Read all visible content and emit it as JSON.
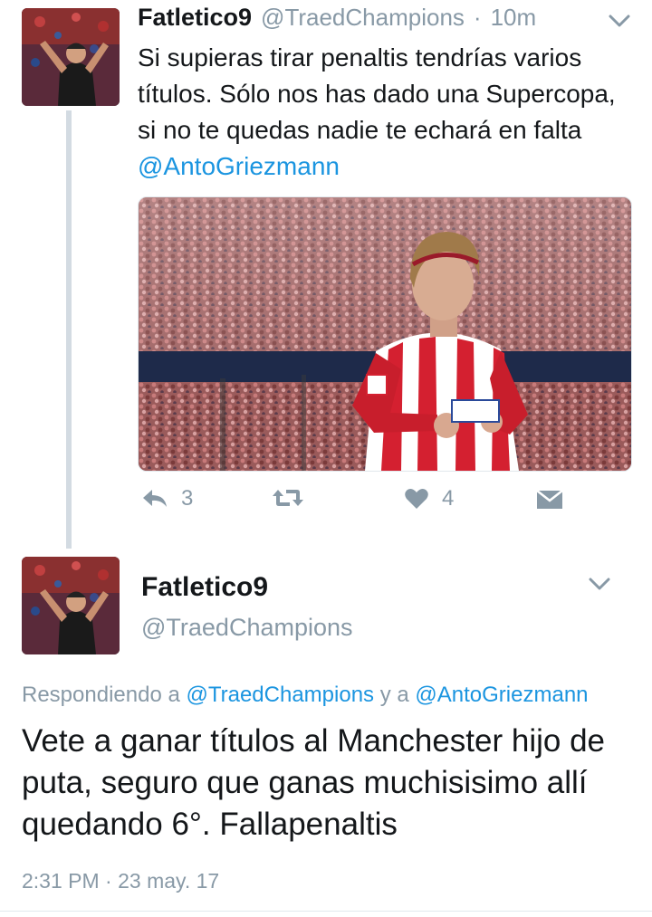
{
  "tweet1": {
    "display_name": "Fatletico9",
    "handle": "@TraedChampions",
    "separator": "·",
    "time": "10m",
    "text": "Si supieras tirar penaltis tendrías varios títulos. Sólo nos has dado una Supercopa, si no te quedas nadie te echará en falta",
    "mention": "@AntoGriezmann",
    "actions": {
      "reply_count": "3",
      "like_count": "4"
    },
    "icons": [
      "reply-icon",
      "retweet-icon",
      "heart-icon",
      "direct-message-icon",
      "chevron-down-icon"
    ]
  },
  "tweet2": {
    "display_name": "Fatletico9",
    "handle": "@TraedChampions",
    "replying_prefix": "Respondiendo a",
    "replying_user1": "@TraedChampions",
    "replying_conj": "y a",
    "replying_user2": "@AntoGriezmann",
    "text": "Vete a ganar títulos al Manchester hijo de puta, seguro que ganas muchisisimo allí quedando 6°. Fallapenaltis",
    "time": "2:31 PM",
    "separator": "·",
    "date": "23 may. 17"
  },
  "colors": {
    "link": "#1b95e0",
    "muted": "#8899a6",
    "text": "#14171a",
    "thread_line": "#d3dbe2"
  }
}
